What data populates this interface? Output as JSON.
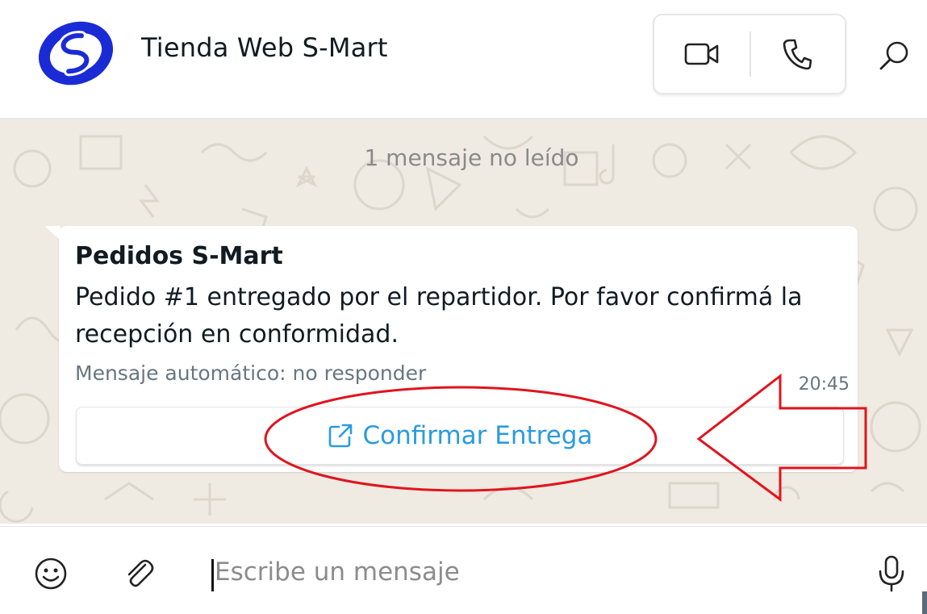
{
  "header": {
    "title": "Tienda Web S-Mart",
    "logo_icon": "s-mart-logo",
    "video_call_icon": "video-camera-icon",
    "voice_call_icon": "phone-icon",
    "search_icon": "search-icon"
  },
  "chat": {
    "unread_banner": "1 mensaje no leído",
    "message": {
      "sender": "Pedidos S-Mart",
      "body": "Pedido #1 entregado por el repartidor. Por favor confirmá la recepción en conformidad.",
      "footer": "Mensaje automático: no responder",
      "time": "20:45",
      "action_button": {
        "label": "Confirmar Entrega",
        "icon": "external-link-icon"
      }
    }
  },
  "composer": {
    "placeholder": "Escribe un mensaje",
    "emoji_icon": "emoji-icon",
    "attach_icon": "paperclip-icon",
    "mic_icon": "microphone-icon"
  },
  "colors": {
    "link_blue": "#2a9bde",
    "annotation_red": "#e0141e",
    "logo_blue": "#1a2bd6",
    "chat_background": "#efeae2"
  }
}
